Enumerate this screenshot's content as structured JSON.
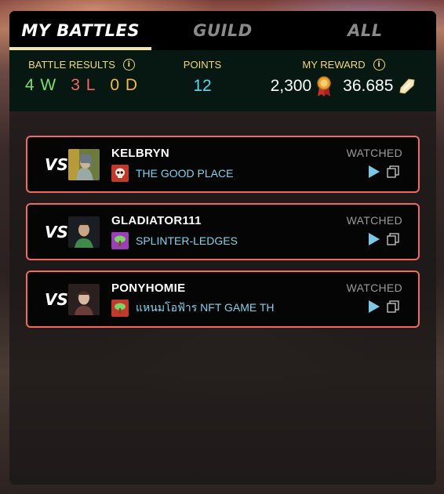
{
  "tabs": [
    {
      "label": "MY BATTLES",
      "active": true
    },
    {
      "label": "GUILD",
      "active": false
    },
    {
      "label": "ALL",
      "active": false
    }
  ],
  "stats": {
    "battle_results": {
      "label": "BATTLE RESULTS",
      "wins": "4 W",
      "losses": "3 L",
      "draws": "0 D"
    },
    "points": {
      "label": "POINTS",
      "value": "12"
    },
    "reward": {
      "label": "MY REWARD",
      "rank_points": "2,300",
      "credits": "36.685"
    }
  },
  "colors": {
    "accent": "#f2e3b0",
    "win": "#7be06a",
    "loss": "#f06a62",
    "draw": "#f6b93b",
    "points": "#5fd3f0",
    "card_border": "#ef6b60",
    "guild_text": "#7fd3ec"
  },
  "battles": [
    {
      "vs": "VS",
      "player": "KELBRYN",
      "guild": "THE GOOD PLACE",
      "guild_icon": "skull-crest-icon",
      "status": "WATCHED"
    },
    {
      "vs": "VS",
      "player": "GLADIATOR111",
      "guild": "SPLINTER-LEDGES",
      "guild_icon": "tree-crest-icon",
      "status": "WATCHED"
    },
    {
      "vs": "VS",
      "player": "PONYHOMIE",
      "guild": "แหนมโอฟ้าร NFT GAME TH",
      "guild_icon": "tree-crest-icon",
      "status": "WATCHED"
    }
  ]
}
